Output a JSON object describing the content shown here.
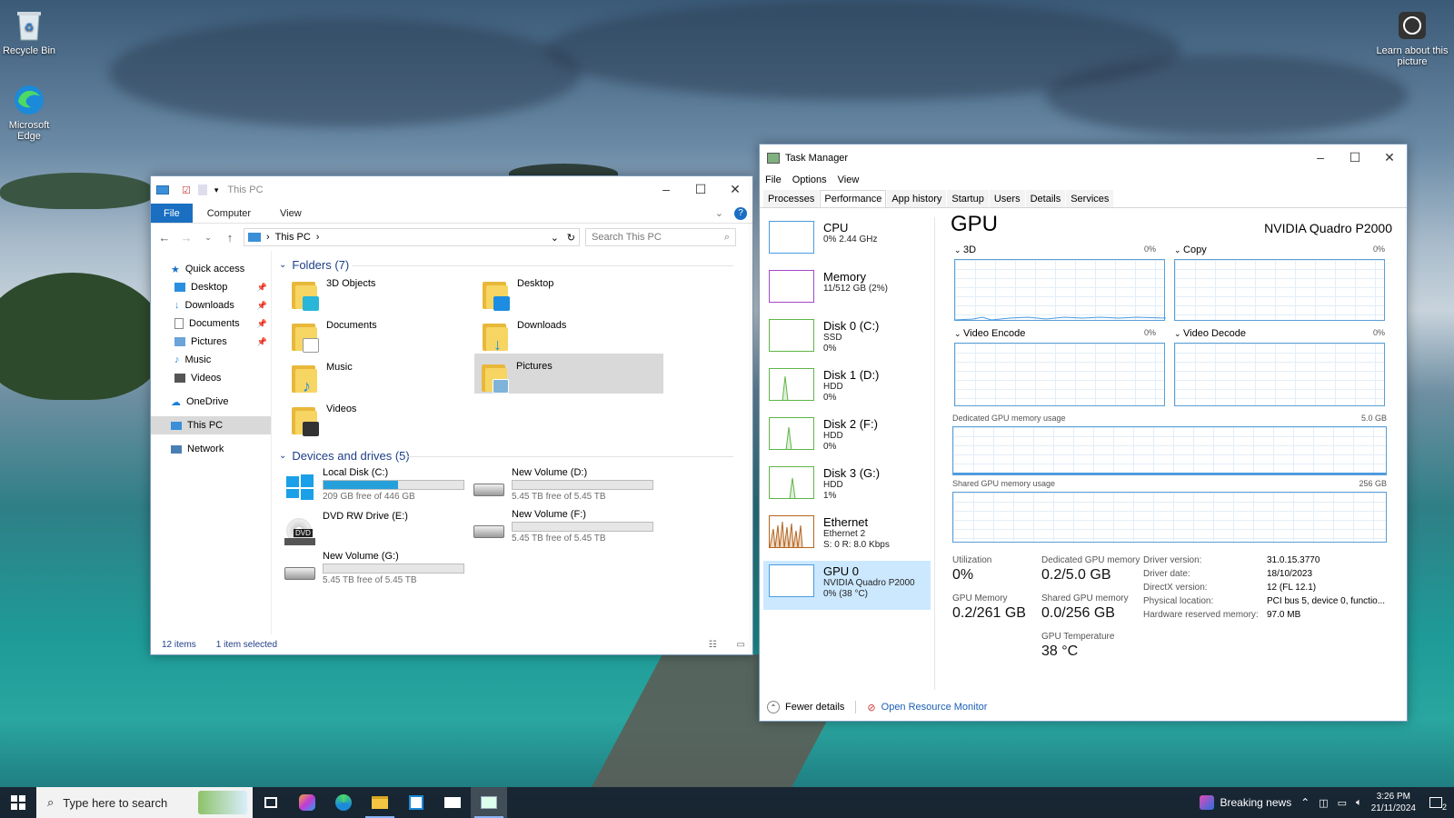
{
  "desktop": {
    "icons": [
      {
        "label": "Recycle Bin"
      },
      {
        "label": "Microsoft Edge"
      }
    ],
    "learn_picture": "Learn about this picture"
  },
  "explorer": {
    "title": "This PC",
    "ribbon_tabs": [
      "File",
      "Computer",
      "View"
    ],
    "address": "This PC",
    "search_placeholder": "Search This PC",
    "nav": {
      "quick_access": "Quick access",
      "quick_items": [
        "Desktop",
        "Downloads",
        "Documents",
        "Pictures",
        "Music",
        "Videos"
      ],
      "onedrive": "OneDrive",
      "this_pc": "This PC",
      "network": "Network"
    },
    "folders_header": "Folders (7)",
    "folders": [
      "3D Objects",
      "Desktop",
      "Documents",
      "Downloads",
      "Music",
      "Pictures",
      "Videos"
    ],
    "drives_header": "Devices and drives (5)",
    "drives": [
      {
        "name": "Local Disk (C:)",
        "free": "209 GB free of 446 GB",
        "used_fraction": 0.53
      },
      {
        "name": "New Volume (D:)",
        "free": "5.45 TB free of 5.45 TB",
        "used_fraction": 0.0
      },
      {
        "name": "DVD RW Drive (E:)",
        "free": "",
        "used_fraction": null,
        "badge": "DVD"
      },
      {
        "name": "New Volume (F:)",
        "free": "5.45 TB free of 5.45 TB",
        "used_fraction": 0.0
      },
      {
        "name": "New Volume (G:)",
        "free": "5.45 TB free of 5.45 TB",
        "used_fraction": 0.0
      }
    ],
    "status_items": "12 items",
    "status_selected": "1 item selected"
  },
  "taskmgr": {
    "title": "Task Manager",
    "menu": [
      "File",
      "Options",
      "View"
    ],
    "tabs": [
      "Processes",
      "Performance",
      "App history",
      "Startup",
      "Users",
      "Details",
      "Services"
    ],
    "sidebar": [
      {
        "name": "CPU",
        "l1": "0% 2.44 GHz",
        "l2": ""
      },
      {
        "name": "Memory",
        "l1": "11/512 GB (2%)",
        "l2": ""
      },
      {
        "name": "Disk 0 (C:)",
        "l1": "SSD",
        "l2": "0%"
      },
      {
        "name": "Disk 1 (D:)",
        "l1": "HDD",
        "l2": "0%"
      },
      {
        "name": "Disk 2 (F:)",
        "l1": "HDD",
        "l2": "0%"
      },
      {
        "name": "Disk 3 (G:)",
        "l1": "HDD",
        "l2": "1%"
      },
      {
        "name": "Ethernet",
        "l1": "Ethernet 2",
        "l2": "S: 0 R: 8.0 Kbps"
      },
      {
        "name": "GPU 0",
        "l1": "NVIDIA Quadro P2000",
        "l2": "0% (38 °C)"
      }
    ],
    "gpu": {
      "heading": "GPU",
      "model": "NVIDIA Quadro P2000",
      "engines": [
        {
          "label": "3D",
          "pct": "0%"
        },
        {
          "label": "Copy",
          "pct": "0%"
        },
        {
          "label": "Video Encode",
          "pct": "0%"
        },
        {
          "label": "Video Decode",
          "pct": "0%"
        }
      ],
      "dedicated_label": "Dedicated GPU memory usage",
      "dedicated_max": "5.0 GB",
      "shared_label": "Shared GPU memory usage",
      "shared_max": "256 GB",
      "stats": {
        "utilization_k": "Utilization",
        "utilization_v": "0%",
        "dedicated_k": "Dedicated GPU memory",
        "dedicated_v": "0.2/5.0 GB",
        "gpumem_k": "GPU Memory",
        "gpumem_v": "0.2/261 GB",
        "shared_k": "Shared GPU memory",
        "shared_v": "0.0/256 GB",
        "temp_k": "GPU Temperature",
        "temp_v": "38 °C"
      },
      "props": [
        {
          "k": "Driver version:",
          "v": "31.0.15.3770"
        },
        {
          "k": "Driver date:",
          "v": "18/10/2023"
        },
        {
          "k": "DirectX version:",
          "v": "12 (FL 12.1)"
        },
        {
          "k": "Physical location:",
          "v": "PCI bus 5, device 0, functio..."
        },
        {
          "k": "Hardware reserved memory:",
          "v": "97.0 MB"
        }
      ]
    },
    "fewer_details": "Fewer details",
    "open_resmon": "Open Resource Monitor"
  },
  "taskbar": {
    "search_placeholder": "Type here to search",
    "news": "Breaking news",
    "time": "3:26 PM",
    "date": "21/11/2024",
    "notif_count": "2"
  }
}
